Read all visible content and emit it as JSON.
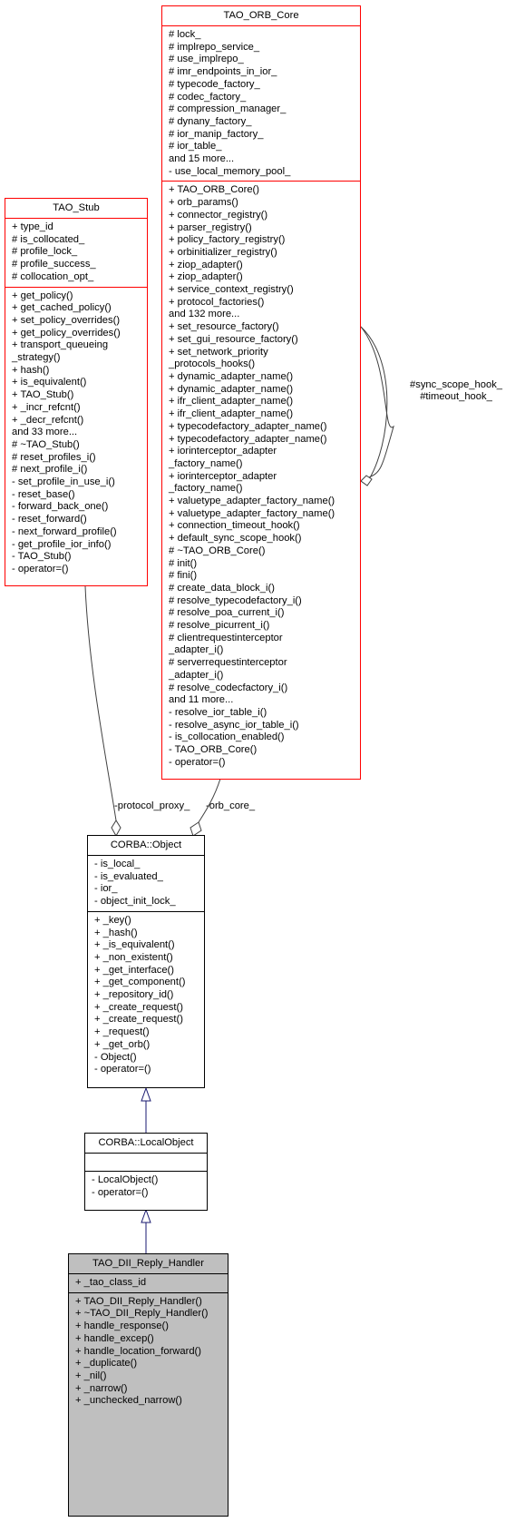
{
  "diagram": {
    "classes": {
      "tao_orb_core": {
        "name": "TAO_ORB_Core",
        "attributes": [
          "# lock_",
          "# implrepo_service_",
          "# use_implrepo_",
          "# imr_endpoints_in_ior_",
          "# typecode_factory_",
          "# codec_factory_",
          "# compression_manager_",
          "# dynany_factory_",
          "# ior_manip_factory_",
          "# ior_table_",
          "and 15 more...",
          "- use_local_memory_pool_"
        ],
        "methods": [
          "+ TAO_ORB_Core()",
          "+ orb_params()",
          "+ connector_registry()",
          "+ parser_registry()",
          "+ policy_factory_registry()",
          "+ orbinitializer_registry()",
          "+ ziop_adapter()",
          "+ ziop_adapter()",
          "+ service_context_registry()",
          "+ protocol_factories()",
          "and 132 more...",
          "+ set_resource_factory()",
          "+ set_gui_resource_factory()",
          "+ set_network_priority",
          "_protocols_hooks()",
          "+ dynamic_adapter_name()",
          "+ dynamic_adapter_name()",
          "+ ifr_client_adapter_name()",
          "+ ifr_client_adapter_name()",
          "+ typecodefactory_adapter_name()",
          "+ typecodefactory_adapter_name()",
          "+ iorinterceptor_adapter",
          "_factory_name()",
          "+ iorinterceptor_adapter",
          "_factory_name()",
          "+ valuetype_adapter_factory_name()",
          "+ valuetype_adapter_factory_name()",
          "+ connection_timeout_hook()",
          "+ default_sync_scope_hook()",
          "# ~TAO_ORB_Core()",
          "# init()",
          "# fini()",
          "# create_data_block_i()",
          "# resolve_typecodefactory_i()",
          "# resolve_poa_current_i()",
          "# resolve_picurrent_i()",
          "# clientrequestinterceptor",
          "_adapter_i()",
          "# serverrequestinterceptor",
          "_adapter_i()",
          "# resolve_codecfactory_i()",
          "and 11 more...",
          "- resolve_ior_table_i()",
          "- resolve_async_ior_table_i()",
          "- is_collocation_enabled()",
          "- TAO_ORB_Core()",
          "- operator=()"
        ]
      },
      "tao_stub": {
        "name": "TAO_Stub",
        "attributes": [
          "+ type_id",
          "# is_collocated_",
          "# profile_lock_",
          "# profile_success_",
          "# collocation_opt_"
        ],
        "methods": [
          "+ get_policy()",
          "+ get_cached_policy()",
          "+ set_policy_overrides()",
          "+ get_policy_overrides()",
          "+ transport_queueing",
          "_strategy()",
          "+ hash()",
          "+ is_equivalent()",
          "+ TAO_Stub()",
          "+ _incr_refcnt()",
          "+ _decr_refcnt()",
          "and 33 more...",
          "# ~TAO_Stub()",
          "# reset_profiles_i()",
          "# next_profile_i()",
          "- set_profile_in_use_i()",
          "- reset_base()",
          "- forward_back_one()",
          "- reset_forward()",
          "- next_forward_profile()",
          "- get_profile_ior_info()",
          "- TAO_Stub()",
          "- operator=()"
        ]
      },
      "corba_object": {
        "name": "CORBA::Object",
        "attributes": [
          "- is_local_",
          "- is_evaluated_",
          "- ior_",
          "- object_init_lock_"
        ],
        "methods": [
          "+ _key()",
          "+ _hash()",
          "+ _is_equivalent()",
          "+ _non_existent()",
          "+ _get_interface()",
          "+ _get_component()",
          "+ _repository_id()",
          "+ _create_request()",
          "+ _create_request()",
          "+ _request()",
          "+ _get_orb()",
          "- Object()",
          "- operator=()"
        ]
      },
      "corba_localobject": {
        "name": "CORBA::LocalObject",
        "attributes": [],
        "methods": [
          "- LocalObject()",
          "- operator=()"
        ]
      },
      "tao_dii_reply_handler": {
        "name": "TAO_DII_Reply_Handler",
        "attributes": [
          "+ _tao_class_id"
        ],
        "methods": [
          "+ TAO_DII_Reply_Handler()",
          "+ ~TAO_DII_Reply_Handler()",
          "+ handle_response()",
          "+ handle_excep()",
          "+ handle_location_forward()",
          "+ _duplicate()",
          "+ _nil()",
          "+ _narrow()",
          "+ _unchecked_narrow()"
        ]
      }
    },
    "edge_labels": {
      "protocol_proxy": "-protocol_proxy_",
      "orb_core": "-orb_core_",
      "self_assoc_line1": "#sync_scope_hook_",
      "self_assoc_line2": "#timeout_hook_"
    },
    "colors": {
      "external_border": "#ff0000",
      "internal_border": "#000000",
      "focus_fill": "#bfbfbf",
      "inheritance_arrow": "#191970",
      "association_line": "#404040"
    }
  }
}
